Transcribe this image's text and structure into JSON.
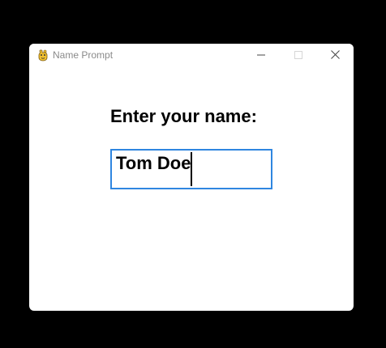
{
  "window": {
    "title": "Name Prompt",
    "app_icon": "pygame-snake-icon",
    "controls": {
      "minimize": "minimize-icon",
      "maximize": "maximize-icon",
      "close": "close-icon"
    }
  },
  "form": {
    "prompt_label": "Enter your name:",
    "name_value": "Tom Doe"
  },
  "colors": {
    "desktop_background": "#000000",
    "window_background": "#ffffff",
    "input_border_focus": "#2f86e0",
    "title_text": "#8a8a8a"
  }
}
